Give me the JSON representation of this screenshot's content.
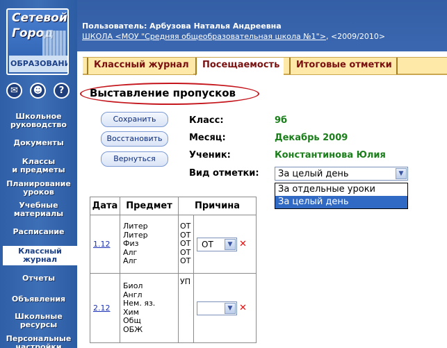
{
  "logo": {
    "line1": "Сетевой",
    "line2": "Город",
    "line3": "ОБРАЗОВАНИ"
  },
  "sidebar_icons": [
    "mail-icon",
    "users-icon",
    "help-icon"
  ],
  "sidebar_icon_glyphs": [
    "✉",
    "☻",
    "?"
  ],
  "nav": [
    {
      "label": "Школьное\nруководство"
    },
    {
      "label": "Документы"
    },
    {
      "label": "Классы\nи предметы"
    },
    {
      "label": "Планирование\nуроков"
    },
    {
      "label": "Учебные\nматериалы"
    },
    {
      "label": "Расписание"
    },
    {
      "label": "Классный\nжурнал",
      "active": true
    },
    {
      "label": "Отчеты"
    },
    {
      "label": "Объявления"
    },
    {
      "label": "Школьные\nресурсы"
    },
    {
      "label": "Персональные\nнастройки"
    }
  ],
  "header": {
    "user": "Пользователь: Арбузова Наталья Андреевна",
    "school_link": "ШКОЛА <МОУ \"Средняя общеобразовательная школа №1\">",
    "year": ", <2009/2010>"
  },
  "tabs": [
    "Классный журнал",
    "Посещаемость",
    "Итоговые отметки"
  ],
  "selected_tab": "Посещаемость",
  "page_title": "Выставление пропусков",
  "buttons": {
    "save": "Сохранить",
    "restore": "Восстановить",
    "back": "Вернуться"
  },
  "fields": {
    "class_label": "Класс:",
    "class_value": "9б",
    "month_label": "Месяц:",
    "month_value": "Декабрь 2009",
    "student_label": "Ученик:",
    "student_value": "Константинова Юлия",
    "mark_type_label": "Вид отметки:",
    "mark_type_value": "За целый день"
  },
  "dropdown_options": [
    "За отдельные уроки",
    "За целый день"
  ],
  "dropdown_highlighted": "За целый день",
  "table": {
    "headers": [
      "Дата",
      "Предмет",
      "Причина"
    ],
    "rows": [
      {
        "date": "1.12",
        "subjects": [
          "Литер",
          "Литер",
          "Физ",
          "Алг",
          "Алг"
        ],
        "codes": [
          "ОТ",
          "ОТ",
          "ОТ",
          "ОТ",
          "ОТ"
        ],
        "reason": "ОТ"
      },
      {
        "date": "2.12",
        "subjects": [
          "Биол",
          "Англ",
          "Нем. яз.",
          "Хим",
          "Общ",
          "ОБЖ"
        ],
        "codes": [
          "УП"
        ],
        "reason": ""
      }
    ]
  },
  "colors": {
    "sidebar": "#3a67b0",
    "accent_red": "#c4161c",
    "value_green": "#1a7f1a",
    "tab_bg": "#ffe9a8"
  }
}
